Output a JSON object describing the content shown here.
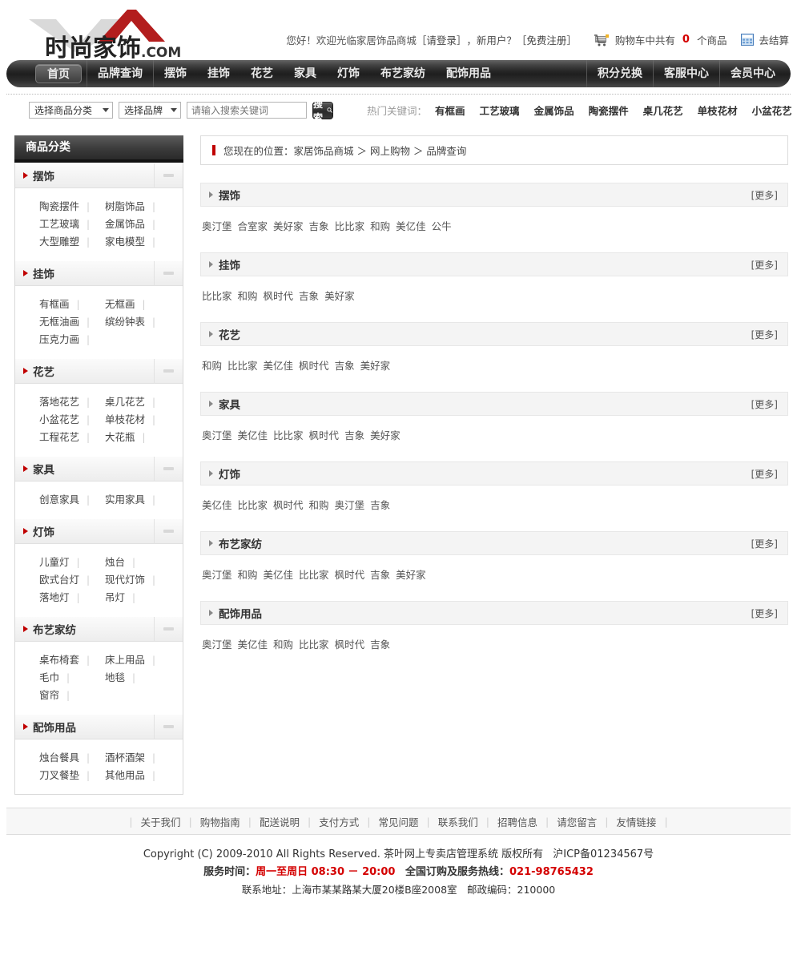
{
  "site": {
    "logo_text": "时尚家饰",
    "logo_suffix": ".COM"
  },
  "topbar": {
    "greeting": "您好！欢迎光临家居饰品商城",
    "login": "［请登录］",
    "newuser": "，新用户？",
    "register": "［免费注册］",
    "cart_icon": "shopping-cart-icon",
    "cart_prefix": "购物车中共有",
    "cart_count": "0",
    "cart_suffix": "个商品",
    "checkout_icon": "checkout-calculator-icon",
    "checkout": "去结算",
    "accent_red": "#d40000"
  },
  "nav": {
    "home": "首页",
    "brand_query": "品牌查询",
    "categories": [
      "摆饰",
      "挂饰",
      "花艺",
      "家具",
      "灯饰",
      "布艺家纺",
      "配饰用品"
    ],
    "right_items": [
      "积分兑换",
      "客服中心",
      "会员中心"
    ]
  },
  "search": {
    "category_select": "选择商品分类",
    "brand_select": "选择品牌",
    "keyword_placeholder": "请输入搜索关键词",
    "keyword_value": "",
    "button": "搜索",
    "button_icon": "magnifier-icon",
    "hot_label": "热门关键词：",
    "hot_keywords": [
      "有框画",
      "工艺玻璃",
      "金属饰品",
      "陶瓷摆件",
      "桌几花艺",
      "单枝花材",
      "小盆花艺"
    ]
  },
  "sidebar": {
    "title": "商品分类",
    "groups": [
      {
        "name": "摆饰",
        "items": [
          "陶瓷摆件",
          "树脂饰品",
          "工艺玻璃",
          "金属饰品",
          "大型雕塑",
          "家电模型"
        ]
      },
      {
        "name": "挂饰",
        "items": [
          "有框画",
          "无框画",
          "无框油画",
          "缤纷钟表",
          "压克力画"
        ]
      },
      {
        "name": "花艺",
        "items": [
          "落地花艺",
          "桌几花艺",
          "小盆花艺",
          "单枝花材",
          "工程花艺",
          "大花瓶"
        ]
      },
      {
        "name": "家具",
        "items": [
          "创意家具",
          "实用家具"
        ]
      },
      {
        "name": "灯饰",
        "items": [
          "儿童灯",
          "烛台",
          "欧式台灯",
          "现代灯饰",
          "落地灯",
          "吊灯"
        ]
      },
      {
        "name": "布艺家纺",
        "items": [
          "桌布椅套",
          "床上用品",
          "毛巾",
          "地毯",
          "窗帘"
        ]
      },
      {
        "name": "配饰用品",
        "items": [
          "烛台餐具",
          "酒杯酒架",
          "刀叉餐垫",
          "其他用品"
        ]
      }
    ]
  },
  "breadcrumb": {
    "prefix": "您现在的位置：",
    "path": "家居饰品商城 ＞ 网上购物 ＞ 品牌查询"
  },
  "main": {
    "more_label": "[更多]",
    "sections": [
      {
        "title": "摆饰",
        "brands": [
          "奥汀堡",
          "合室家",
          "美好家",
          "吉象",
          "比比家",
          "和购",
          "美亿佳",
          "公牛"
        ]
      },
      {
        "title": "挂饰",
        "brands": [
          "比比家",
          "和购",
          "枫时代",
          "吉象",
          "美好家"
        ]
      },
      {
        "title": "花艺",
        "brands": [
          "和购",
          "比比家",
          "美亿佳",
          "枫时代",
          "吉象",
          "美好家"
        ]
      },
      {
        "title": "家具",
        "brands": [
          "奥汀堡",
          "美亿佳",
          "比比家",
          "枫时代",
          "吉象",
          "美好家"
        ]
      },
      {
        "title": "灯饰",
        "brands": [
          "美亿佳",
          "比比家",
          "枫时代",
          "和购",
          "奥汀堡",
          "吉象"
        ]
      },
      {
        "title": "布艺家纺",
        "brands": [
          "奥汀堡",
          "和购",
          "美亿佳",
          "比比家",
          "枫时代",
          "吉象",
          "美好家"
        ]
      },
      {
        "title": "配饰用品",
        "brands": [
          "奥汀堡",
          "美亿佳",
          "和购",
          "比比家",
          "枫时代",
          "吉象"
        ]
      }
    ]
  },
  "footer": {
    "links": [
      "关于我们",
      "购物指南",
      "配送说明",
      "支付方式",
      "常见问题",
      "联系我们",
      "招聘信息",
      "请您留言",
      "友情链接"
    ],
    "copyright": "Copyright (C) 2009-2010 All Rights Reserved. 茶叶网上专卖店管理系统 版权所有",
    "icp": "沪ICP备01234567号",
    "service_label": "服务时间：",
    "service_time": "周一至周日 08:30 － 20:00",
    "hotline_label": "全国订购及服务热线：",
    "hotline": "021-98765432",
    "address": "联系地址：上海市某某路某大厦20楼B座2008室　邮政编码：210000"
  }
}
